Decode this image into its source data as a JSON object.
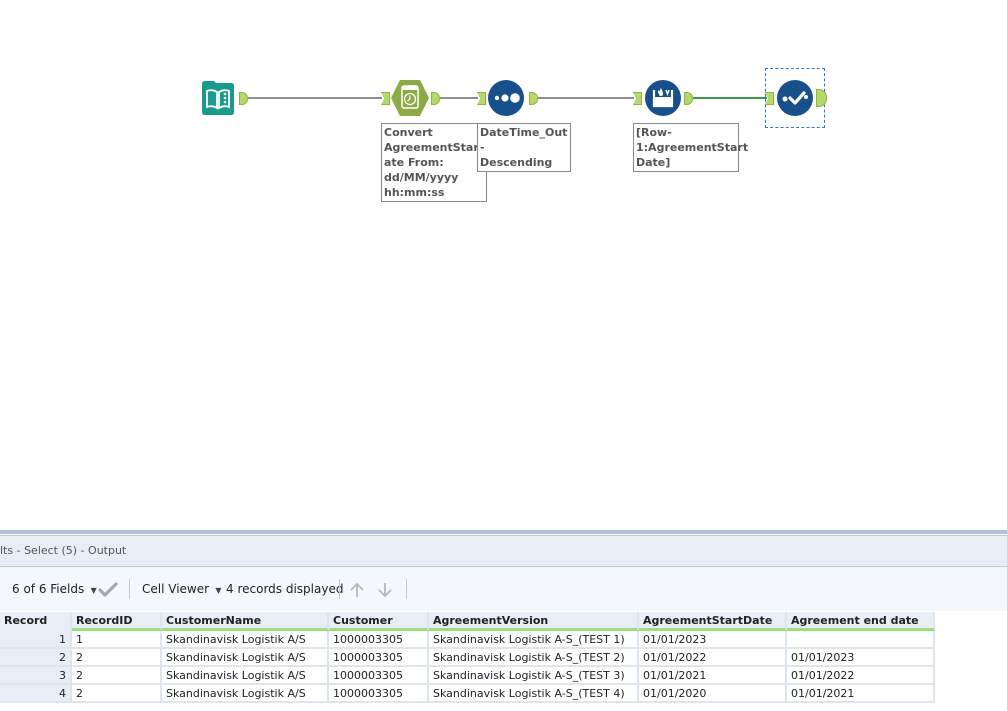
{
  "workflow": {
    "tools": [
      {
        "id": "input",
        "type": "input-data",
        "label": ""
      },
      {
        "id": "datetime",
        "type": "datetime",
        "label": "Convert\nAgreementStartD\nate From:\ndd/MM/yyyy\nhh:mm:ss"
      },
      {
        "id": "sort",
        "type": "sort",
        "label": "DateTime_Out -\nDescending"
      },
      {
        "id": "multirow",
        "type": "multi-row-formula",
        "label": "[Row-\n1:AgreementStart\nDate]"
      },
      {
        "id": "select",
        "type": "select",
        "label": "",
        "selected": true
      }
    ],
    "colors": {
      "input": "#1a9a8a",
      "datetime": "#8cab45",
      "blue_tool": "#17508a",
      "anchor": "#b5d86a",
      "active_connection": "#3a9a4a"
    }
  },
  "results": {
    "title": "lts - Select (5) - Output",
    "toolbar": {
      "fields_label": "6 of 6 Fields",
      "viewer_label": "Cell Viewer",
      "records_label": "4 records displayed"
    },
    "columns": [
      "Record",
      "RecordID",
      "CustomerName",
      "Customer",
      "AgreementVersion",
      "AgreementStartDate",
      "Agreement end date"
    ],
    "rows": [
      [
        "1",
        "1",
        "Skandinavisk Logistik A/S",
        "1000003305",
        "Skandinavisk Logistik A-S_(TEST 1)",
        "01/01/2023",
        ""
      ],
      [
        "2",
        "2",
        "Skandinavisk Logistik A/S",
        "1000003305",
        "Skandinavisk Logistik A-S_(TEST 2)",
        "01/01/2022",
        "01/01/2023"
      ],
      [
        "3",
        "2",
        "Skandinavisk Logistik A/S",
        "1000003305",
        "Skandinavisk Logistik A-S_(TEST 3)",
        "01/01/2021",
        "01/01/2022"
      ],
      [
        "4",
        "2",
        "Skandinavisk Logistik A/S",
        "1000003305",
        "Skandinavisk Logistik A-S_(TEST 4)",
        "01/01/2020",
        "01/01/2021"
      ]
    ]
  }
}
